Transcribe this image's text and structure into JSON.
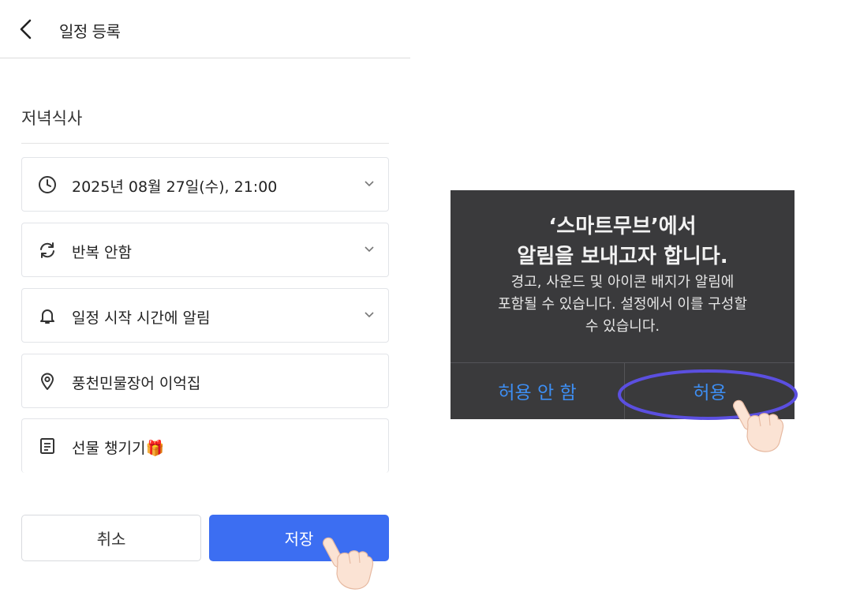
{
  "header": {
    "title": "일정 등록",
    "back_icon": "chevron-left-icon"
  },
  "event": {
    "title_value": "저녁식사",
    "datetime": "2025년 08월 27일(수), 21:00",
    "repeat": "반복 안함",
    "reminder": "일정 시작 시간에 알림",
    "location": "풍천민물장어 이억집",
    "memo": "선물 챙기기🎁"
  },
  "buttons": {
    "cancel_label": "취소",
    "save_label": "저장"
  },
  "alert": {
    "title": "‘스마트무브’에서\n알림을 보내고자 합니다.",
    "message": "경고, 사운드 및 아이콘 배지가 알림에\n포함될 수 있습니다. 설정에서 이를 구성할\n수 있습니다.",
    "deny_label": "허용 안 함",
    "allow_label": "허용"
  },
  "colors": {
    "primary": "#3c6ef2",
    "alert_bg": "#3a3a3c",
    "alert_button": "#3d8ef3",
    "highlight": "#5b4fe0"
  }
}
